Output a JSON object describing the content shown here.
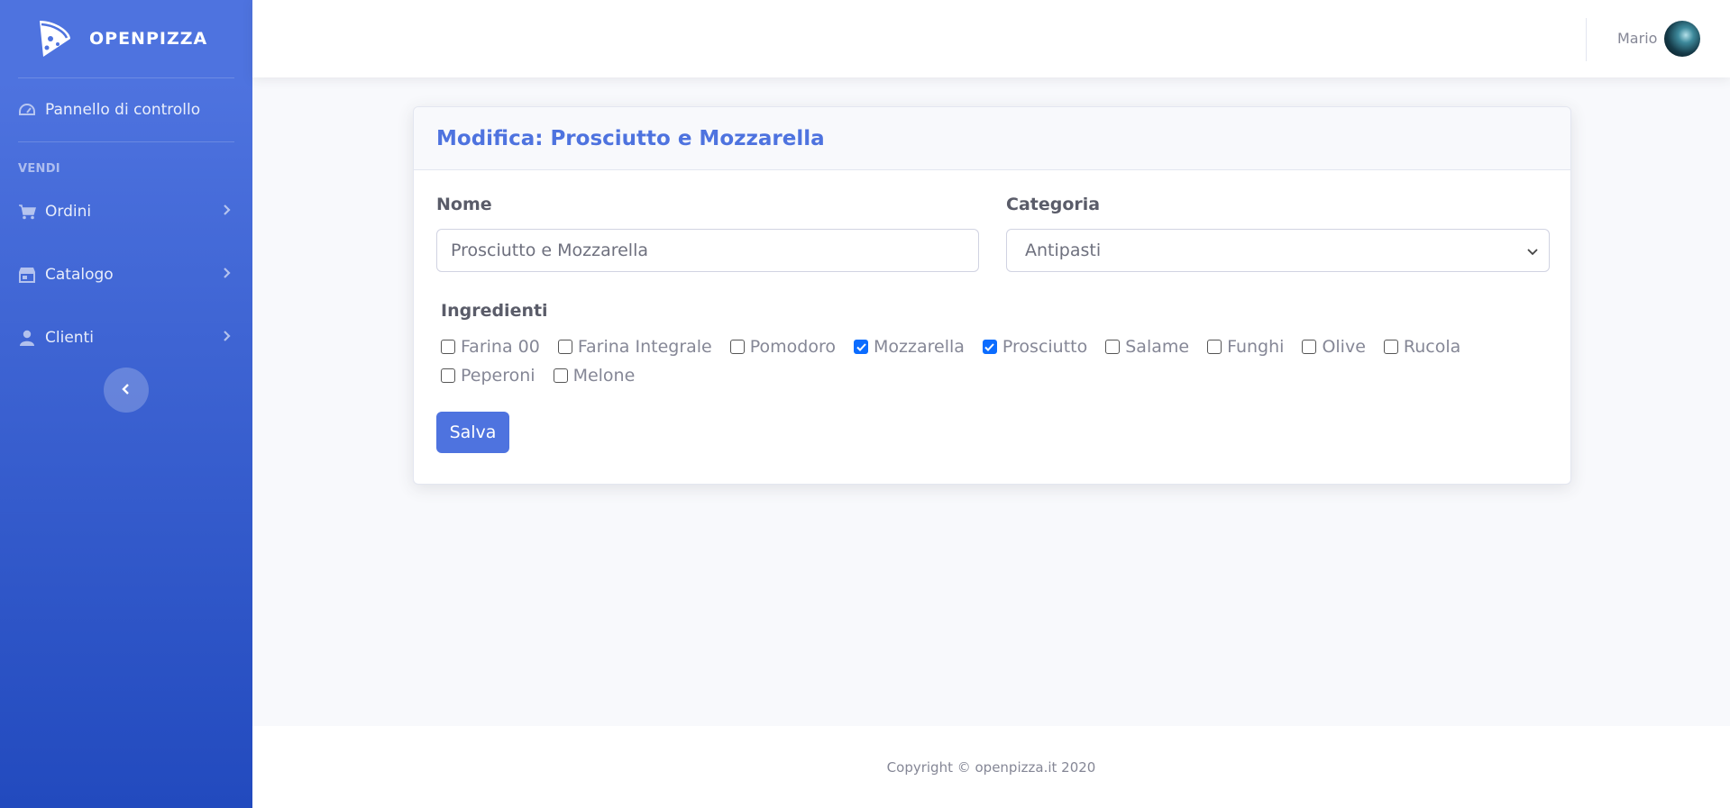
{
  "brand": {
    "name": "OPENPIZZA",
    "logo_icon": "pizza-slice-icon"
  },
  "sidebar": {
    "dashboard": {
      "label": "Pannello di controllo",
      "icon": "tachometer-icon"
    },
    "section_heading": "VENDI",
    "items": [
      {
        "label": "Ordini",
        "icon": "cart-icon"
      },
      {
        "label": "Catalogo",
        "icon": "store-icon"
      },
      {
        "label": "Clienti",
        "icon": "user-icon"
      }
    ],
    "toggle_icon": "chevron-left-icon"
  },
  "topbar": {
    "username": "Mario"
  },
  "card": {
    "title": "Modifica: Prosciutto e Mozzarella",
    "nome_label": "Nome",
    "nome_value": "Prosciutto e Mozzarella",
    "categoria_label": "Categoria",
    "categoria_value": "Antipasti",
    "ingredienti_label": "Ingredienti",
    "ingredients": [
      {
        "label": "Farina 00",
        "checked": false
      },
      {
        "label": "Farina Integrale",
        "checked": false
      },
      {
        "label": "Pomodoro",
        "checked": false
      },
      {
        "label": "Mozzarella",
        "checked": true
      },
      {
        "label": "Prosciutto",
        "checked": true
      },
      {
        "label": "Salame",
        "checked": false
      },
      {
        "label": "Funghi",
        "checked": false
      },
      {
        "label": "Olive",
        "checked": false
      },
      {
        "label": "Rucola",
        "checked": false
      },
      {
        "label": "Peperoni",
        "checked": false
      },
      {
        "label": "Melone",
        "checked": false
      }
    ],
    "save_label": "Salva"
  },
  "footer": {
    "copyright": "Copyright © openpizza.it 2020"
  },
  "colors": {
    "primary": "#4e73df",
    "sidebar_end": "#224abe",
    "checkbox": "#0b6cff"
  }
}
